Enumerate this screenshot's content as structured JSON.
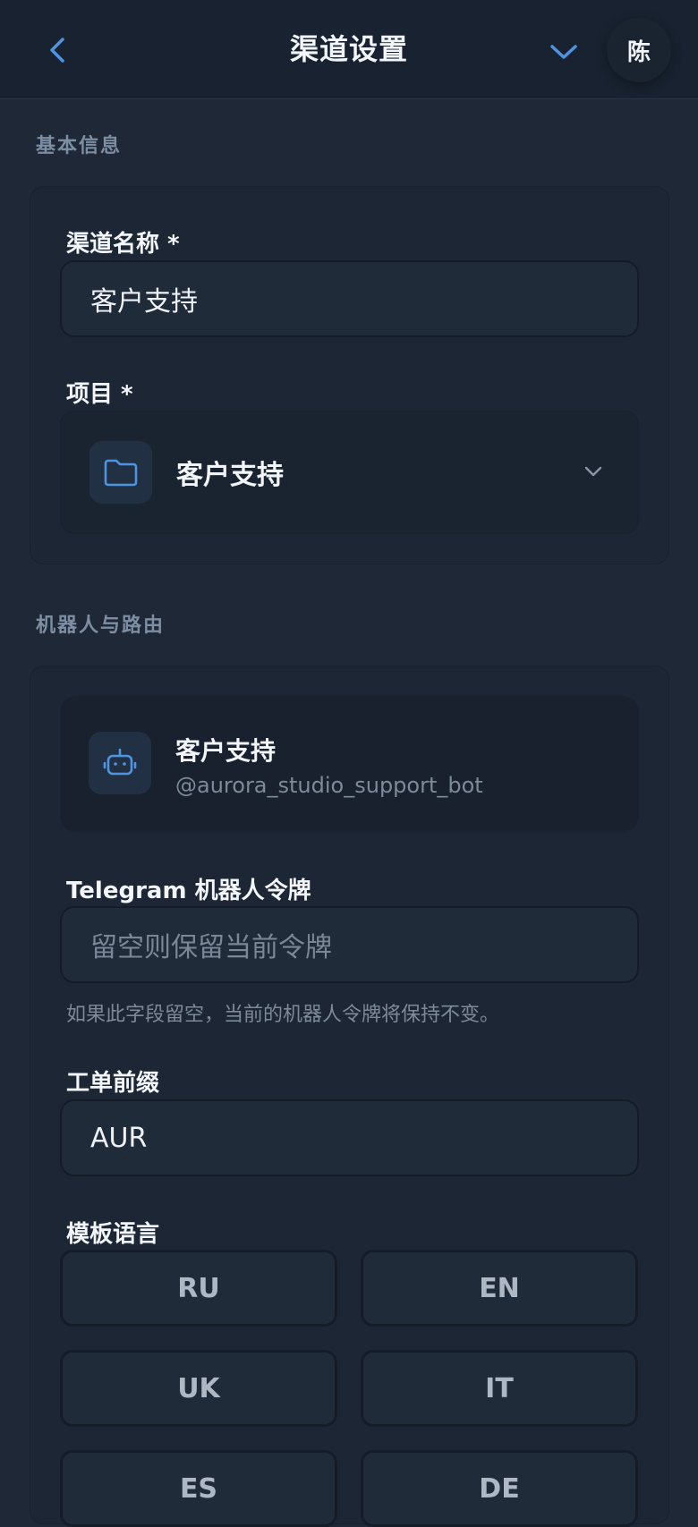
{
  "header": {
    "title": "渠道设置",
    "avatar_text": "陈"
  },
  "sections": {
    "basic_info": "基本信息",
    "bot_routing": "机器人与路由"
  },
  "channel_name": {
    "label": "渠道名称 *",
    "value": "客户支持"
  },
  "project": {
    "label": "项目 *",
    "value": "客户支持"
  },
  "bot": {
    "name": "客户支持",
    "handle": "@aurora_studio_support_bot"
  },
  "token": {
    "label": "Telegram 机器人令牌",
    "placeholder": "留空则保留当前令牌",
    "helper": "如果此字段留空，当前的机器人令牌将保持不变。"
  },
  "ticket_prefix": {
    "label": "工单前缀",
    "value": "AUR"
  },
  "template_language": {
    "label": "模板语言",
    "options": [
      "RU",
      "EN",
      "UK",
      "IT",
      "ES",
      "DE"
    ]
  },
  "colors": {
    "accent": "#4f94e0",
    "background": "#1e2836",
    "header": "#182230",
    "card": "#1d2634"
  },
  "icons": {
    "back": "chevron-left-icon",
    "expand": "chevron-down-icon",
    "project": "folder-icon",
    "bot": "robot-icon"
  }
}
